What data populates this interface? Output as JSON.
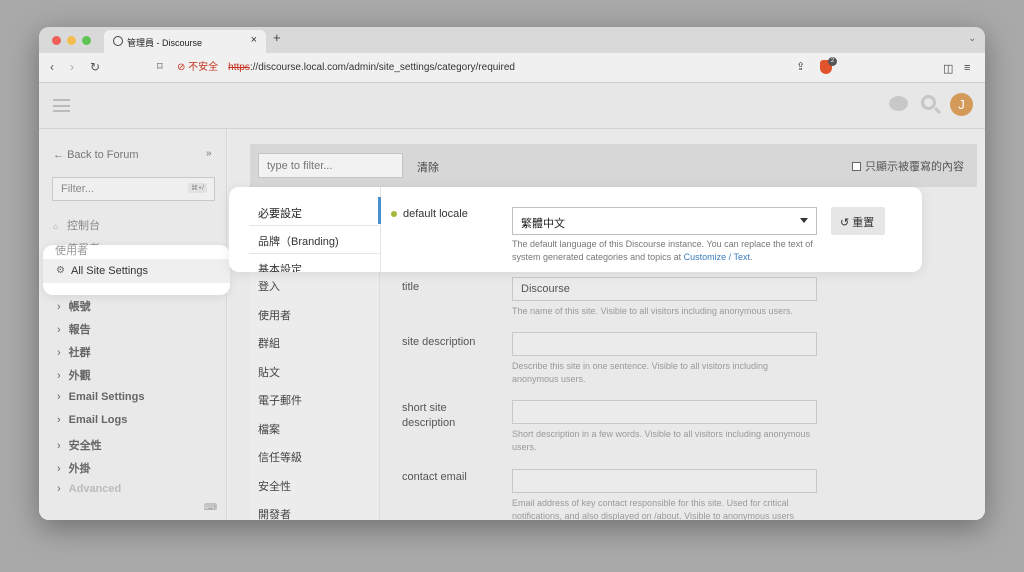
{
  "browser": {
    "tab_title": "管理員 - Discourse",
    "tab_close": "×",
    "new_tab": "+",
    "security_warning": "不安全",
    "url_scheme": "https",
    "url_rest": "://discourse.local.com/admin/site_settings/category/required",
    "brave_count": "2"
  },
  "sidebar": {
    "back": "Back to Forum",
    "filter_placeholder": "Filter...",
    "filter_shortcut": "⌘+/",
    "items": [
      {
        "label": "控制台",
        "icon": "home-icon"
      },
      {
        "label": "使用者",
        "icon": "users-icon"
      },
      {
        "label": "All Site Settings",
        "icon": "gear-icon"
      }
    ],
    "groups": [
      "帳號",
      "報告",
      "社群",
      "外觀",
      "Email Settings",
      "Email Logs",
      "安全性",
      "外掛",
      "Advanced"
    ]
  },
  "main": {
    "filter_placeholder": "type to filter...",
    "clear": "清除",
    "only_overridden": "只顯示被覆寫的內容",
    "categories": [
      "必要設定",
      "品牌（Branding)",
      "基本設定",
      "登入",
      "使用者",
      "群組",
      "貼文",
      "電子郵件",
      "檔案",
      "信任等級",
      "安全性",
      "開發者"
    ],
    "settings": {
      "default_locale": {
        "label": "default locale",
        "value": "繁體中文",
        "reset": "重置",
        "desc": "The default language of this Discourse instance. You can replace the text of system generated categories and topics at",
        "link": "Customize / Text",
        "desc_end": "."
      },
      "title": {
        "label": "title",
        "value": "Discourse",
        "desc": "The name of this site. Visible to all visitors including anonymous users."
      },
      "site_description": {
        "label": "site description",
        "value": "",
        "desc": "Describe this site in one sentence. Visible to all visitors including anonymous users."
      },
      "short_site_description": {
        "label": "short site description",
        "value": "",
        "desc": "Short description in a few words. Visible to all visitors including anonymous users."
      },
      "contact_email": {
        "label": "contact email",
        "value": "",
        "desc": "Email address of key contact responsible for this site. Used for critical notifications, and also displayed on /about. Visible to anonymous users"
      }
    }
  },
  "header": {
    "avatar_letter": "J"
  },
  "colors": {
    "accent": "#4a8fce",
    "link": "#3a7dc0",
    "status_dot": "#a6b63a",
    "avatar": "#d39a59",
    "brave": "#e0532b"
  }
}
